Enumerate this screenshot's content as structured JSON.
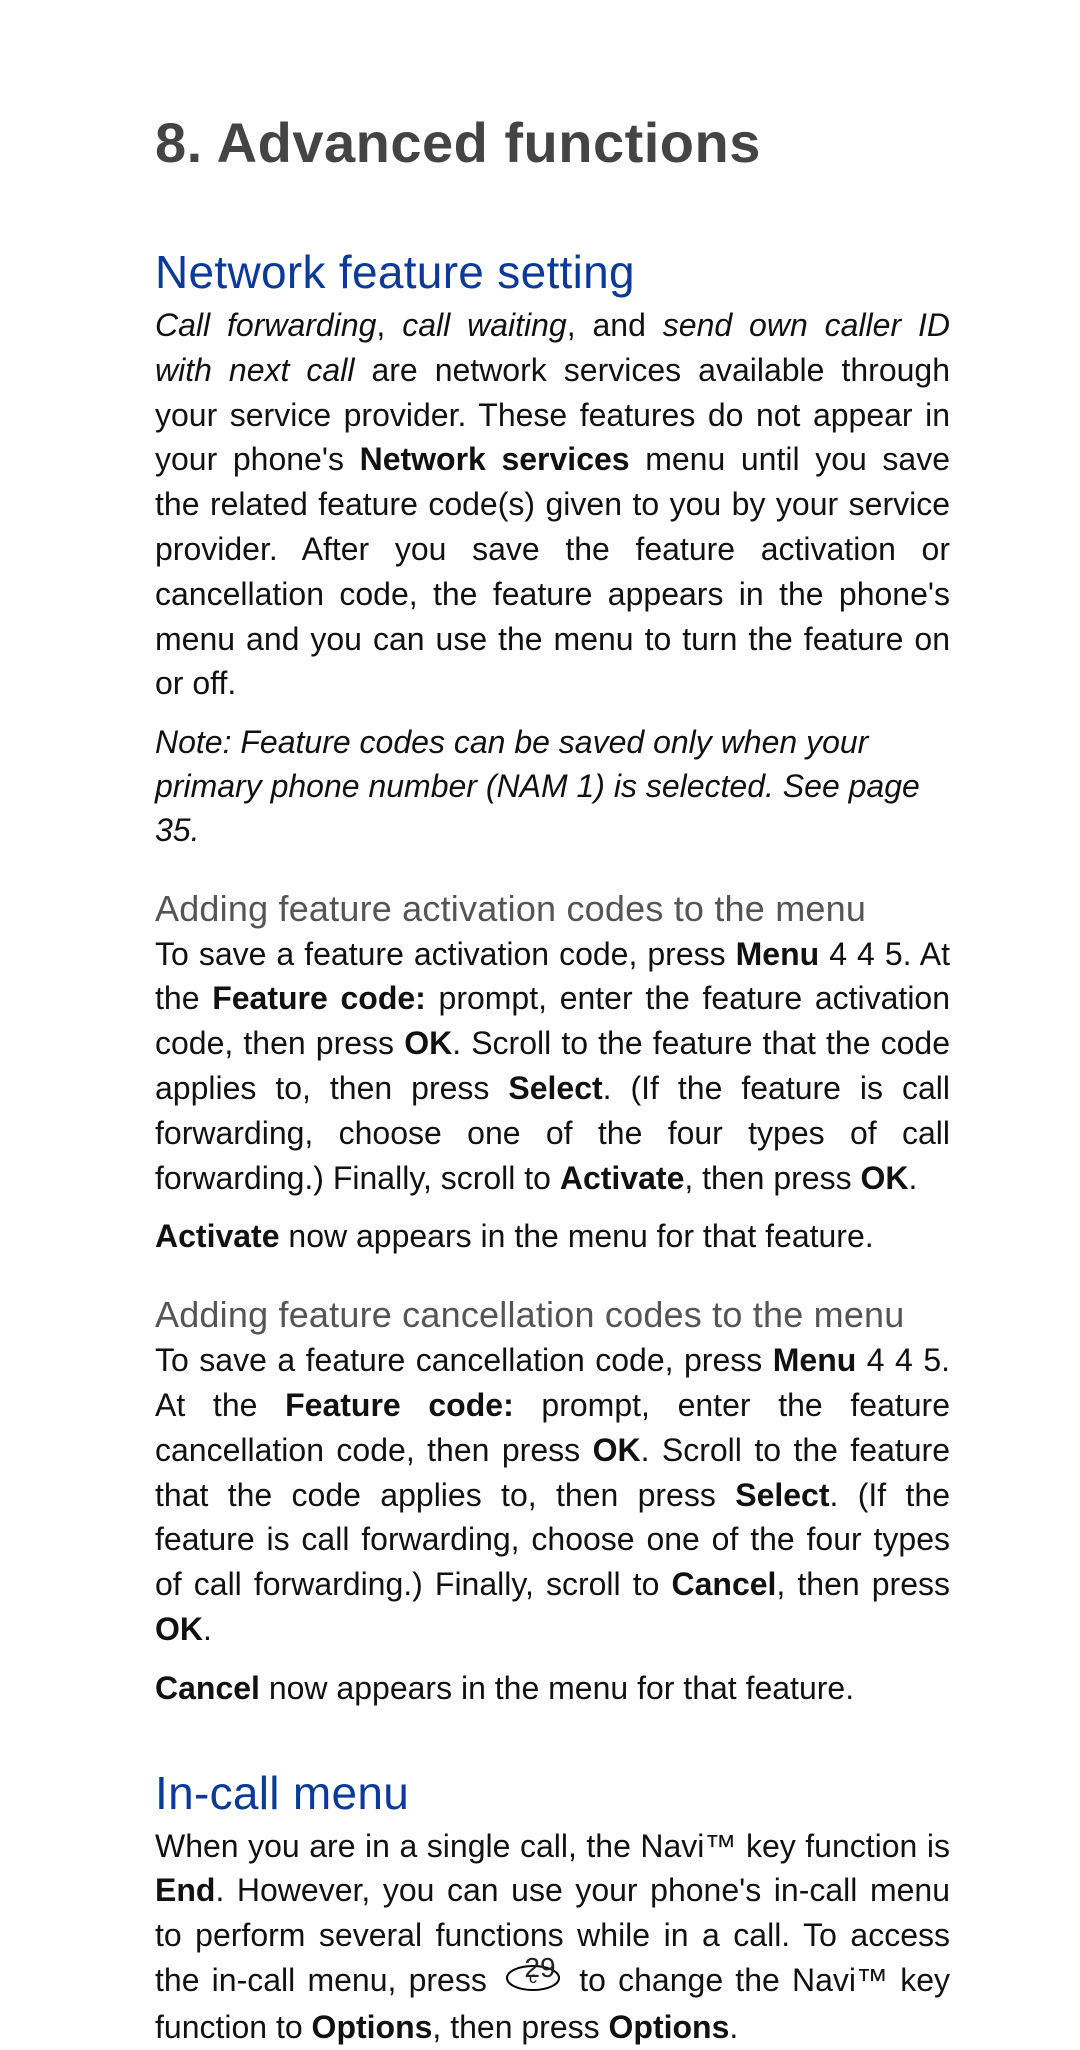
{
  "chapter_title": "8. Advanced functions",
  "section_network": {
    "heading": "Network feature setting",
    "intro": {
      "it1": "Call forwarding",
      "sep1": ", ",
      "it2": "call waiting",
      "sep2": ", and ",
      "it3": "send own caller ID with next call",
      "tail1": " are network services available through your service provider. These features do not appear in your phone's ",
      "bd1": "Network services",
      "tail2": " menu until you save the related feature code(s) given to you by your service provider. After you save the feature activation or cancellation code, the feature appears in the phone's menu and you can use the menu to turn the feature on or off."
    },
    "note": "Note:  Feature codes can be saved only when your primary phone number (NAM 1) is selected. See page 35."
  },
  "sub_activation": {
    "heading": "Adding feature activation codes to the menu",
    "para": {
      "t1": "To save a feature activation code, press ",
      "bd_menu": "Menu",
      "t2": " 4 4 5. At the ",
      "bd_fc": "Feature code:",
      "t3": " prompt, enter the feature activation code, then press ",
      "bd_ok1": "OK",
      "t4": ". Scroll to the feature that the code applies to, then press ",
      "bd_select": "Select",
      "t5": ". (If the feature is call forwarding, choose one of the four types of call forwarding.) Finally, scroll to ",
      "bd_activate": "Activate",
      "t6": ", then press ",
      "bd_ok2": "OK",
      "t7": "."
    },
    "result": {
      "bd": "Activate",
      "tail": " now appears in the menu for that feature."
    }
  },
  "sub_cancellation": {
    "heading": "Adding feature cancellation codes to the menu",
    "para": {
      "t1": "To save a feature cancellation code, press ",
      "bd_menu": "Menu",
      "t2": " 4 4 5. At the ",
      "bd_fc": "Feature code:",
      "t3": " prompt, enter the feature cancellation code, then press ",
      "bd_ok1": "OK",
      "t4": ". Scroll to the feature that the code applies to, then press ",
      "bd_select": "Select",
      "t5": ". (If the feature is call forwarding, choose one of the four types of call forwarding.) Finally, scroll to ",
      "bd_cancel": "Cancel",
      "t6": ", then press ",
      "bd_ok2": "OK",
      "t7": "."
    },
    "result": {
      "bd": "Cancel",
      "tail": " now appears in the menu for that feature."
    }
  },
  "section_incall": {
    "heading": "In-call menu",
    "para": {
      "t1": "When you are in a single call, the Navi™ key function is ",
      "bd_end": "End",
      "t2": ". However, you can use your phone's in-call menu to perform several functions while in a call. To access the in-call menu, press ",
      "icon_label": "c",
      "t3": " to change the Navi™ key function to ",
      "bd_options1": "Options",
      "t4": ", then press ",
      "bd_options2": "Options",
      "t5": "."
    }
  },
  "page_number": "29"
}
